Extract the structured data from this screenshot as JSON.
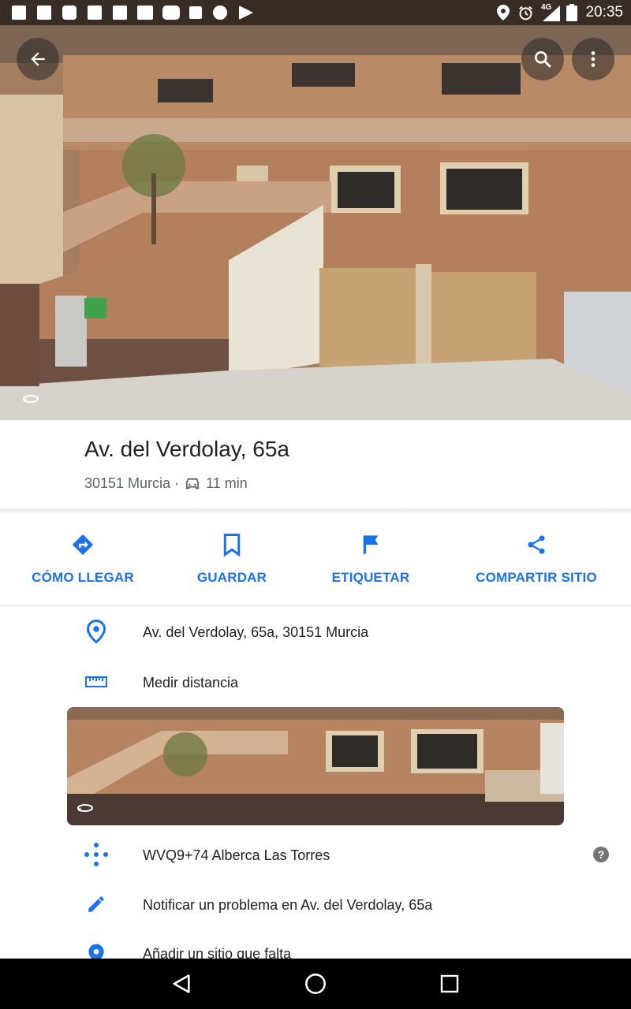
{
  "status_bar": {
    "time": "20:35",
    "network": "4G",
    "notification_icons": [
      "facebook-icon",
      "facebook-icon",
      "outlook-icon",
      "facebook-icon",
      "messages-icon",
      "gmail-icon",
      "youtube-icon",
      "image-icon",
      "telegram-icon",
      "play-store-icon"
    ]
  },
  "toolbar": {
    "back_icon": "arrow-back-icon",
    "search_icon": "search-icon",
    "more_icon": "more-vert-icon"
  },
  "place": {
    "title": "Av. del Verdolay, 65a",
    "locality": "30151 Murcia ·",
    "drive_time": "11 min"
  },
  "actions": [
    {
      "label": "CÓMO LLEGAR",
      "icon": "directions-icon"
    },
    {
      "label": "GUARDAR",
      "icon": "bookmark-icon"
    },
    {
      "label": "ETIQUETAR",
      "icon": "flag-icon"
    },
    {
      "label": "COMPARTIR SITIO",
      "icon": "share-icon"
    }
  ],
  "details": {
    "address": "Av. del Verdolay, 65a, 30151 Murcia",
    "measure": "Medir distancia",
    "plus_code": "WVQ9+74 Alberca Las Torres",
    "report": "Notificar un problema en Av. del Verdolay, 65a",
    "add_place": "Añadir un sitio que falta"
  },
  "colors": {
    "accent": "#1a73e8",
    "text_primary": "#202124",
    "text_secondary": "#5f6368"
  }
}
